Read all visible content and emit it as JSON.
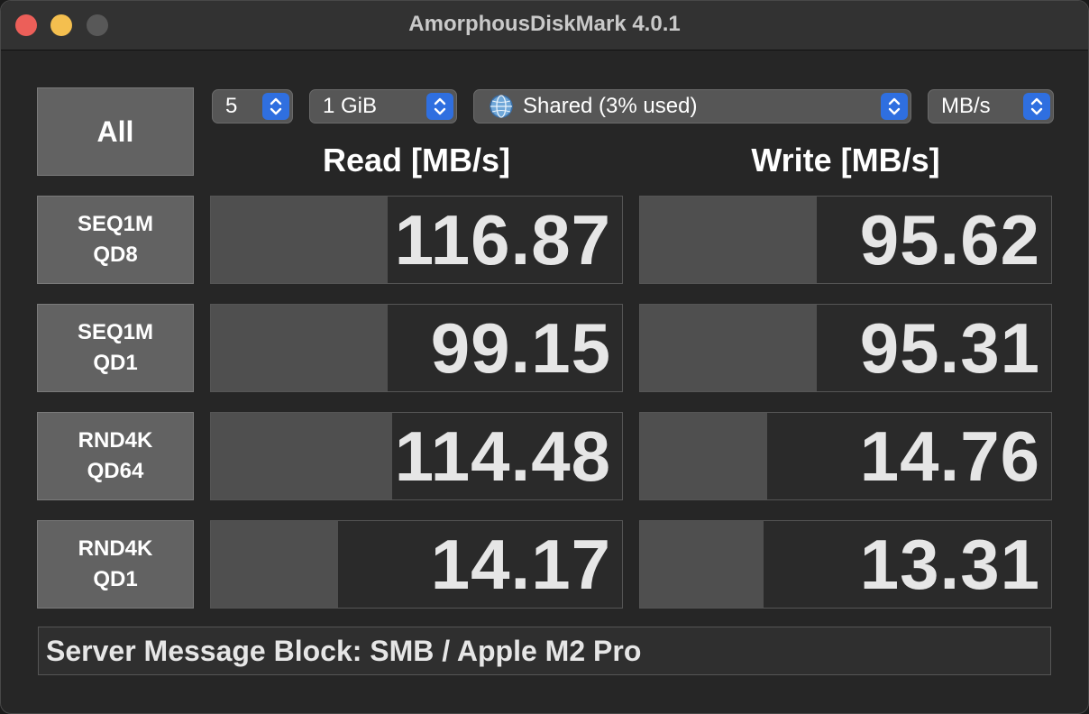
{
  "window": {
    "title": "AmorphousDiskMark 4.0.1"
  },
  "controls": {
    "all_label": "All",
    "count": "5",
    "size": "1 GiB",
    "target": "Shared (3% used)",
    "unit": "MB/s"
  },
  "headers": {
    "read": "Read [MB/s]",
    "write": "Write [MB/s]"
  },
  "tests": [
    {
      "line1": "SEQ1M",
      "line2": "QD8",
      "read": "116.87",
      "write": "95.62",
      "read_fill": 0.43,
      "write_fill": 0.43
    },
    {
      "line1": "SEQ1M",
      "line2": "QD1",
      "read": "99.15",
      "write": "95.31",
      "read_fill": 0.43,
      "write_fill": 0.43
    },
    {
      "line1": "RND4K",
      "line2": "QD64",
      "read": "114.48",
      "write": "14.76",
      "read_fill": 0.44,
      "write_fill": 0.31
    },
    {
      "line1": "RND4K",
      "line2": "QD1",
      "read": "14.17",
      "write": "13.31",
      "read_fill": 0.31,
      "write_fill": 0.3
    }
  ],
  "status": "Server Message Block: SMB / Apple M2 Pro"
}
